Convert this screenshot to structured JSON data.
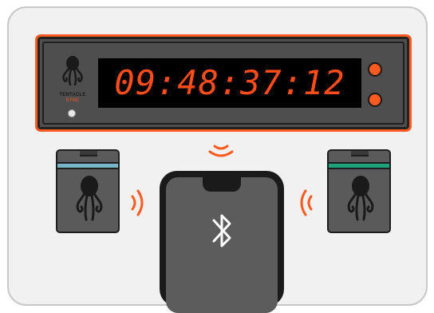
{
  "colors": {
    "accent": "#ff5a1f",
    "device_body": "#4e4e4e",
    "display_text": "#ff4d1a",
    "tag_left_stripe": "#7ab8c9",
    "tag_right_stripe": "#1fa37a",
    "background": "#f1f1f1"
  },
  "device": {
    "brand": "TENTACLE",
    "brand_sub": "SYNC",
    "timecode": "09:48:37:12"
  },
  "icons": {
    "logo": "octopus-icon",
    "bluetooth": "bluetooth-icon",
    "signal": "wireless-signal-icon"
  }
}
